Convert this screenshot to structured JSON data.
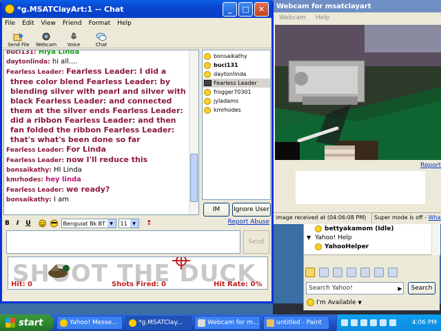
{
  "chat_window": {
    "title": "*g.MSATClayArt:1 -- Chat",
    "menu": [
      "File",
      "Edit",
      "View",
      "Friend",
      "Format",
      "Help"
    ],
    "toolbar": [
      "Send File",
      "Webcam",
      "Voice",
      "Chat"
    ],
    "messages": [
      {
        "nick": "buci131:",
        "text": "Hiya Linda",
        "style": "green"
      },
      {
        "nick": "daytonlinda:",
        "text": "hi all....",
        "style": "plain"
      },
      {
        "nick": "Fearless Leader:",
        "text": "Fearless Leader: I did a",
        "style": "fearless"
      },
      {
        "nick": "",
        "text": "three color blend Fearless Leader: by",
        "style": "fearless"
      },
      {
        "nick": "",
        "text": "blending silver with pearl and silver with",
        "style": "fearless"
      },
      {
        "nick": "",
        "text": "black Fearless Leader: and connected",
        "style": "fearless"
      },
      {
        "nick": "",
        "text": "them at the silver ends Fearless Leader:",
        "style": "fearless"
      },
      {
        "nick": "",
        "text": "did a ribbon Fearless Leader: and then",
        "style": "fearless"
      },
      {
        "nick": "",
        "text": "fan folded the ribbon Fearless Leader:",
        "style": "fearless"
      },
      {
        "nick": "",
        "text": "that's what's been done so far",
        "style": "fearless"
      },
      {
        "nick": "Fearless Leader:",
        "text": "For Linda",
        "style": "fearless"
      },
      {
        "nick": "Fearless Leader:",
        "text": "now I'll reduce this",
        "style": "fearless"
      },
      {
        "nick": "bonsaikathy:",
        "text": "HI Linda",
        "style": "plain"
      },
      {
        "nick": "kmrhodes:",
        "text": "hey linda",
        "style": "pink"
      },
      {
        "nick": "Fearless Leader:",
        "text": "we ready?",
        "style": "fearless"
      },
      {
        "nick": "bonsaikathy:",
        "text": "I am",
        "style": "plain"
      }
    ],
    "buddies": [
      {
        "name": "bonsaikathy",
        "icon": "smile",
        "bold": false,
        "selected": false
      },
      {
        "name": "buci131",
        "icon": "smile",
        "bold": true,
        "selected": false
      },
      {
        "name": "daytonlinda",
        "icon": "smile",
        "bold": false,
        "selected": false
      },
      {
        "name": "Fearless Leader",
        "icon": "webcam",
        "bold": false,
        "selected": true
      },
      {
        "name": "frogger70301",
        "icon": "smile",
        "bold": false,
        "selected": false
      },
      {
        "name": "jyladams",
        "icon": "smile",
        "bold": false,
        "selected": false
      },
      {
        "name": "kmrhodes",
        "icon": "smile",
        "bold": false,
        "selected": false
      }
    ],
    "im_label": "IM",
    "ignore_label": "Ignore User",
    "format": {
      "bold": "B",
      "italic": "I",
      "underline": "U",
      "font": "Benguiat Bk BT",
      "size": "11"
    },
    "report_abuse": "Report Abuse",
    "send_label": "Send",
    "game": {
      "logo": "SHOOT THE DUCK",
      "hit": "Hit: 0",
      "shots": "Shots Fired: 0",
      "rate": "Hit Rate: 0%"
    }
  },
  "webcam_window": {
    "title": "Webcam for msatclayart",
    "menu": [
      "Webcam",
      "Help"
    ],
    "report": "Report",
    "status_received": "image received at (04:06:08 PM)",
    "status_super": "Super mode is off - ",
    "status_link": "What"
  },
  "messenger": {
    "rows": [
      {
        "kind": "contact",
        "text": "bettyakamom (Idle)",
        "bold": true
      },
      {
        "kind": "group",
        "text": "Yahoo! Help",
        "bold": false
      },
      {
        "kind": "contact",
        "text": "YahooHelper",
        "bold": true
      }
    ],
    "search_placeholder": "Search Yahoo!",
    "search_button": "Search",
    "status": "I'm Available"
  },
  "taskbar": {
    "start": "start",
    "tasks": [
      "Yahoo! Messe...",
      "*g.MSATClay...",
      "Webcam for m...",
      "untitled - Paint"
    ],
    "clock": "4:06 PM"
  }
}
